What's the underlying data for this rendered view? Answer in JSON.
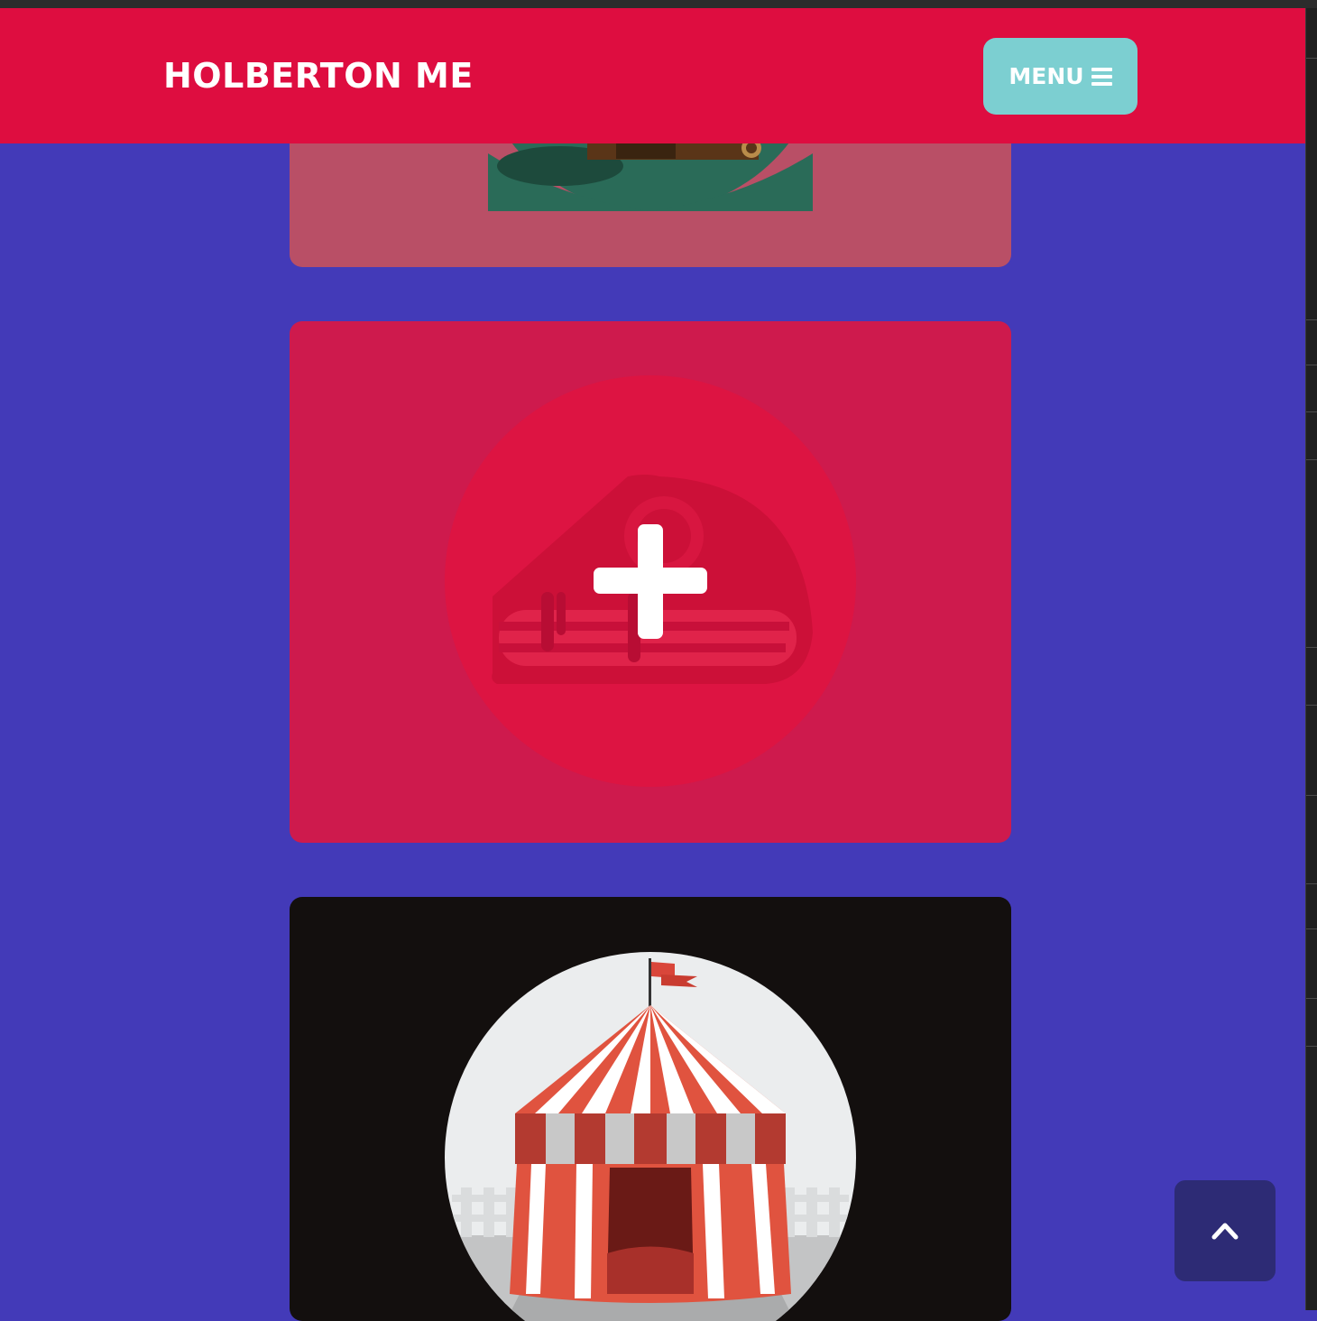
{
  "header": {
    "brand": "HOLBERTON ME",
    "menu_label": "MENU"
  },
  "colors": {
    "navbar": "#de0d40",
    "page_background": "#433ab8",
    "menu_button": "#7ccfd1",
    "card_overlay": "#ce1a4d",
    "back_to_top": "#2d2b75"
  },
  "icons": {
    "menu": "hamburger-icon",
    "overlay": "plus-icon",
    "back_to_top": "chevron-up-icon"
  },
  "portfolio": {
    "items": [
      {
        "image": "cabin-illustration"
      },
      {
        "image": "cake-illustration",
        "state": "hover"
      },
      {
        "image": "circus-tent-illustration"
      }
    ]
  }
}
